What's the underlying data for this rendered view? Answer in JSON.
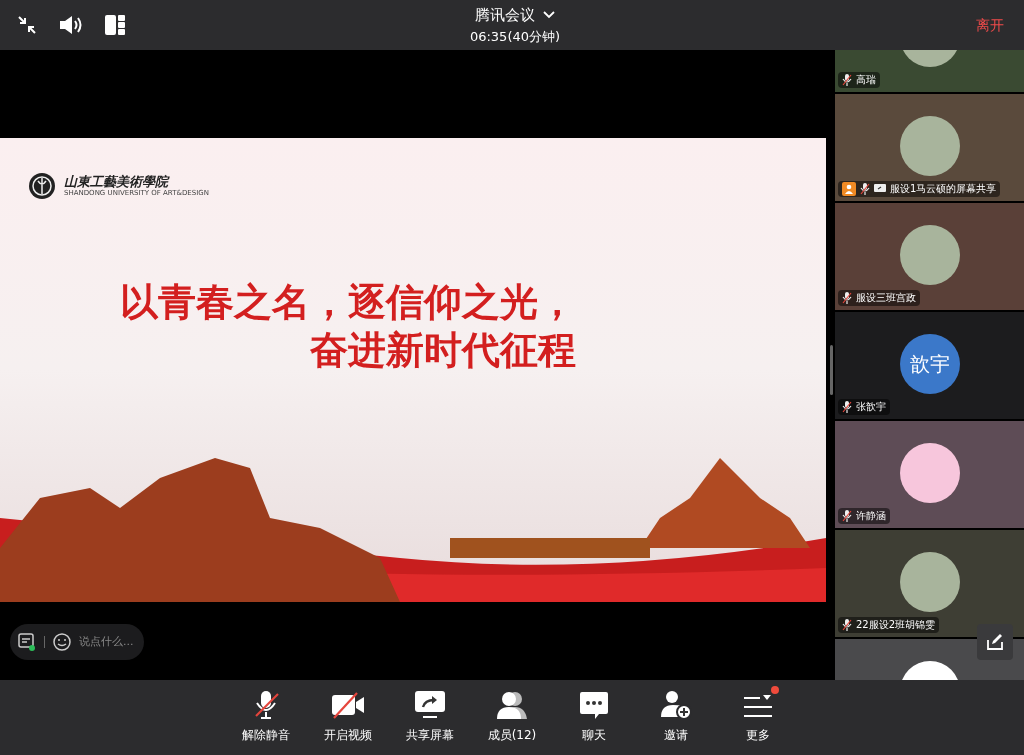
{
  "top_bar": {
    "title": "腾讯会议",
    "elapsed": "06:35(40分钟)",
    "leave": "离开"
  },
  "slide": {
    "logo_name": "山東工藝美術學院",
    "logo_subtitle": "SHANDONG UNIVERSITY OF ART&DESIGN",
    "headline": [
      "以青春之名，逐信仰之光，",
      "奋进新时代征程"
    ]
  },
  "chat_input": {
    "placeholder": "说点什么..."
  },
  "participants": [
    {
      "name": "高瑞",
      "kind": "photo",
      "color": "#3a4a32",
      "sharing": false
    },
    {
      "name": "服设1马云硕的屏幕共享",
      "kind": "photo",
      "color": "#5a4a3c",
      "sharing": true
    },
    {
      "name": "服设三班宫政",
      "kind": "photo",
      "color": "#5a4038",
      "sharing": false
    },
    {
      "name": "张歆宇",
      "kind": "initials",
      "initials": "歆宇",
      "color": "#1c1c1e",
      "sharing": false
    },
    {
      "name": "许静涵",
      "kind": "pink",
      "color": "#5e4c56",
      "sharing": false
    },
    {
      "name": "22服设2班胡锦雯",
      "kind": "photo",
      "color": "#3e3e34",
      "sharing": false
    },
    {
      "kind": "cartoon",
      "color": "#4a4a4c"
    }
  ],
  "toolbar": [
    {
      "label": "解除静音",
      "kind": "mic-off"
    },
    {
      "label": "开启视频",
      "kind": "video-off"
    },
    {
      "label": "共享屏幕",
      "kind": "share"
    },
    {
      "label": "成员(12)",
      "kind": "members"
    },
    {
      "label": "聊天",
      "kind": "chat"
    },
    {
      "label": "邀请",
      "kind": "invite"
    },
    {
      "label": "更多",
      "kind": "more",
      "badge": true
    }
  ]
}
